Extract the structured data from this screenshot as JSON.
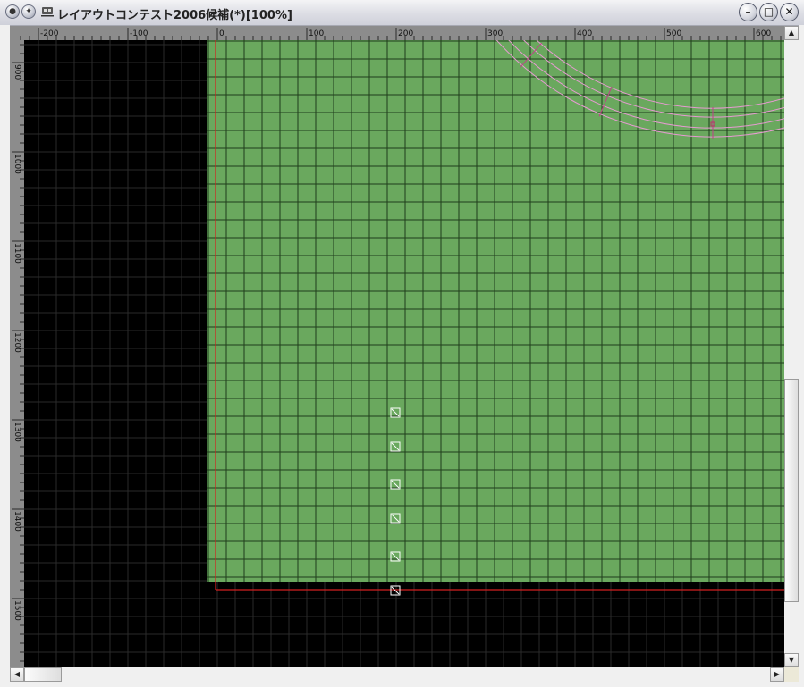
{
  "window": {
    "title": "レイアウトコンテスト2006候補(*)[100%]"
  },
  "title_buttons": {
    "menu_icon": "circle-menu-icon",
    "pin_icon": "pin-icon",
    "app_icon": "train-icon"
  },
  "window_controls": {
    "minimize": "–",
    "maximize": "□",
    "close": "✕"
  },
  "ruler_top": {
    "labels": [
      "-200",
      "-100",
      "0",
      "100",
      "200",
      "300",
      "400",
      "500",
      "600"
    ]
  },
  "ruler_left": {
    "labels": [
      "900",
      "1000",
      "1100",
      "1200",
      "1300",
      "1400",
      "1500"
    ]
  },
  "scrollbars": {
    "up": "▲",
    "down": "▼",
    "left": "◀",
    "right": "▶"
  },
  "colors": {
    "board_green": "#6aa85e",
    "grid_dark": "#1f3d1c",
    "grid_faint": "#2a2a2a",
    "origin_red": "#d42020",
    "track_pink": "#e79ad2"
  },
  "markers": {
    "count": 6
  }
}
